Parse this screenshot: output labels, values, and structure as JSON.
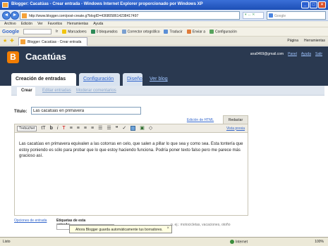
{
  "window": {
    "title": "Blogger: Cacatúas - Crear entrada - Windows Internet Explorer proporcionado por Windows XP",
    "buttons": [
      "_",
      "□",
      "×"
    ]
  },
  "browser": {
    "back_label": "◄",
    "forward_label": "►",
    "url": "http://www.blogger.com/post-create.g?blogID=4368058614238417497",
    "address_actions": "▾ ↔ ✕",
    "search_placeholder": "Google",
    "menus": [
      "Archivo",
      "Edición",
      "Ver",
      "Favoritos",
      "Herramientas",
      "Ayuda"
    ],
    "google_toolbar": {
      "logo": "Google",
      "items": [
        "Ir",
        "Marcadores",
        "0 bloqueados",
        "Corrector ortográfico",
        "Traducir",
        "Enviar a",
        "Configuración"
      ]
    },
    "tab_title": "Blogger: Cacatúas - Crear entrada",
    "tab_tools": [
      "Página",
      "Herramientas"
    ]
  },
  "blogger": {
    "logo_letter": "B",
    "blog_title": "Cacatúas",
    "user_email": "ana0469@gmail.com",
    "header_links": [
      "Panel",
      "Ayuda",
      "Salir"
    ],
    "main_tabs": [
      "Creación de entradas",
      "Configuración",
      "Diseño",
      "Ver blog"
    ],
    "sub_tabs": [
      "Crear",
      "Editar entradas",
      "Moderar comentarios"
    ],
    "editor": {
      "title_label": "Título:",
      "title_value": "Las cacatúas en primavera",
      "html_mode_link": "Edición de HTML",
      "compose_mode_tab": "Redactar",
      "font_select": "Trebuchet",
      "toolbar_buttons": [
        "tT",
        "b",
        "i",
        "T",
        "≡",
        "≡",
        "≡",
        "≡",
        "☰",
        "☰",
        "❝",
        "✓",
        "▦",
        "▣",
        "◇"
      ],
      "preview_link": "Vista previa",
      "body_text": "Las cacatúas en primavera equivalen a las cotorras en celo, que salen a pillar lo que sea y como sea. Esta tontería que estoy poniendo es sólo para probar que lo que estoy haciendo funciona. Podría poner texto falso pero me parece más gracioso así.",
      "post_options_link": "Opciones de entrada",
      "labels_label": "Etiquetas de esta entrada:",
      "labels_hint": "p. ej.: motocicletas, vacaciones, otoño"
    },
    "autosave_tip": "Ahora Blogger guarda automáticamente tus borradores.",
    "autosave_close": "×"
  },
  "status": {
    "text": "Listo",
    "zone": "Internet",
    "zoom": "100%"
  }
}
